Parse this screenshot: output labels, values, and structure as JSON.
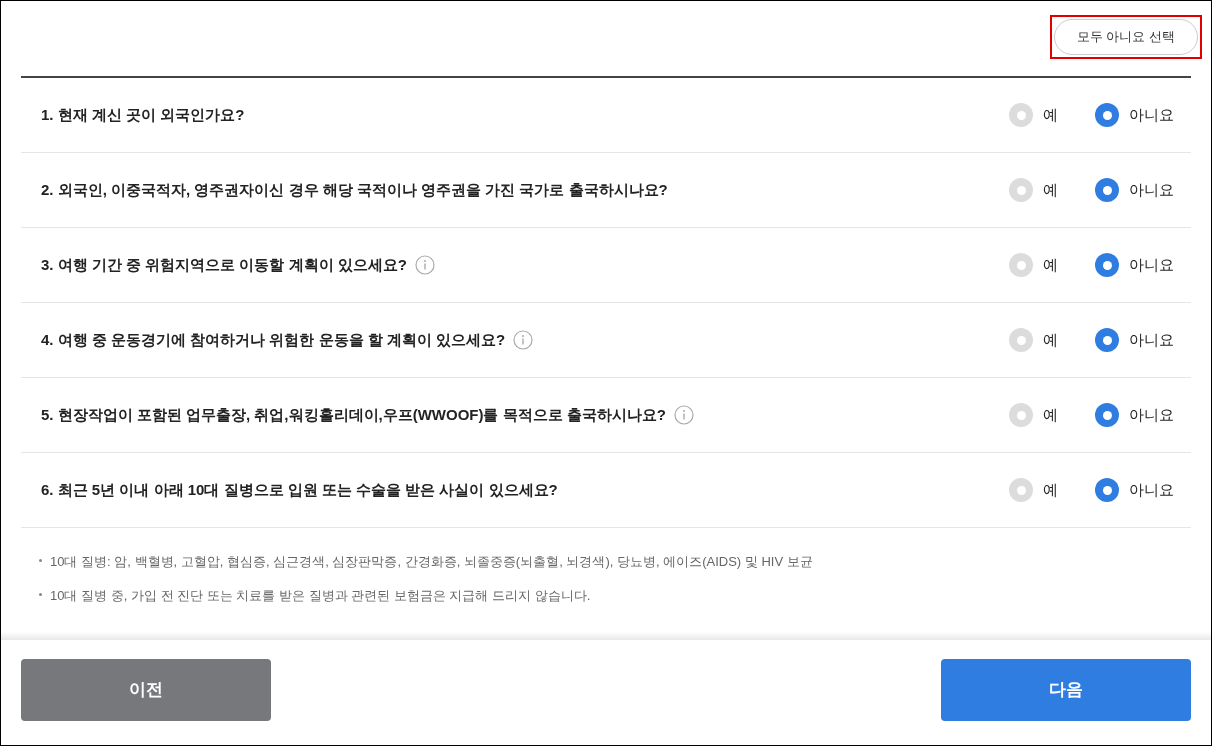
{
  "select_all_button": {
    "label": "모두 아니요 선택",
    "highlighted": true
  },
  "questions": [
    {
      "text": "1. 현재 계신 곳이 외국인가요?",
      "info": false,
      "options": [
        {
          "label": "예",
          "selected": false
        },
        {
          "label": "아니요",
          "selected": true
        }
      ]
    },
    {
      "text": "2. 외국인, 이중국적자, 영주권자이신 경우 해당 국적이나 영주권을 가진 국가로 출국하시나요?",
      "info": false,
      "options": [
        {
          "label": "예",
          "selected": false
        },
        {
          "label": "아니요",
          "selected": true
        }
      ]
    },
    {
      "text": "3. 여행 기간 중 위험지역으로 이동할 계획이 있으세요?",
      "info": true,
      "options": [
        {
          "label": "예",
          "selected": false
        },
        {
          "label": "아니요",
          "selected": true
        }
      ]
    },
    {
      "text": "4. 여행 중 운동경기에 참여하거나 위험한 운동을 할 계획이 있으세요?",
      "info": true,
      "options": [
        {
          "label": "예",
          "selected": false
        },
        {
          "label": "아니요",
          "selected": true
        }
      ]
    },
    {
      "text": "5. 현장작업이 포함된 업무출장, 취업,워킹홀리데이,우프(WWOOF)를 목적으로 출국하시나요?",
      "info": true,
      "options": [
        {
          "label": "예",
          "selected": false
        },
        {
          "label": "아니요",
          "selected": true
        }
      ]
    },
    {
      "text": "6. 최근 5년 이내 아래 10대 질병으로 입원 또는 수술을 받은 사실이 있으세요?",
      "info": false,
      "options": [
        {
          "label": "예",
          "selected": false
        },
        {
          "label": "아니요",
          "selected": true
        }
      ]
    }
  ],
  "notes": [
    "10대 질병: 암, 백혈병, 고혈압, 협심증, 심근경색, 심장판막증, 간경화증, 뇌졸중증(뇌출혈, 뇌경색), 당뇨병, 에이즈(AIDS) 및 HIV 보균",
    "10대 질병 중, 가입 전 진단 또는 치료를 받은 질병과 관련된 보험금은 지급해 드리지 않습니다."
  ],
  "footer_buttons": [
    {
      "label": "이전",
      "kind": "secondary"
    },
    {
      "label": "다음",
      "kind": "primary"
    }
  ]
}
